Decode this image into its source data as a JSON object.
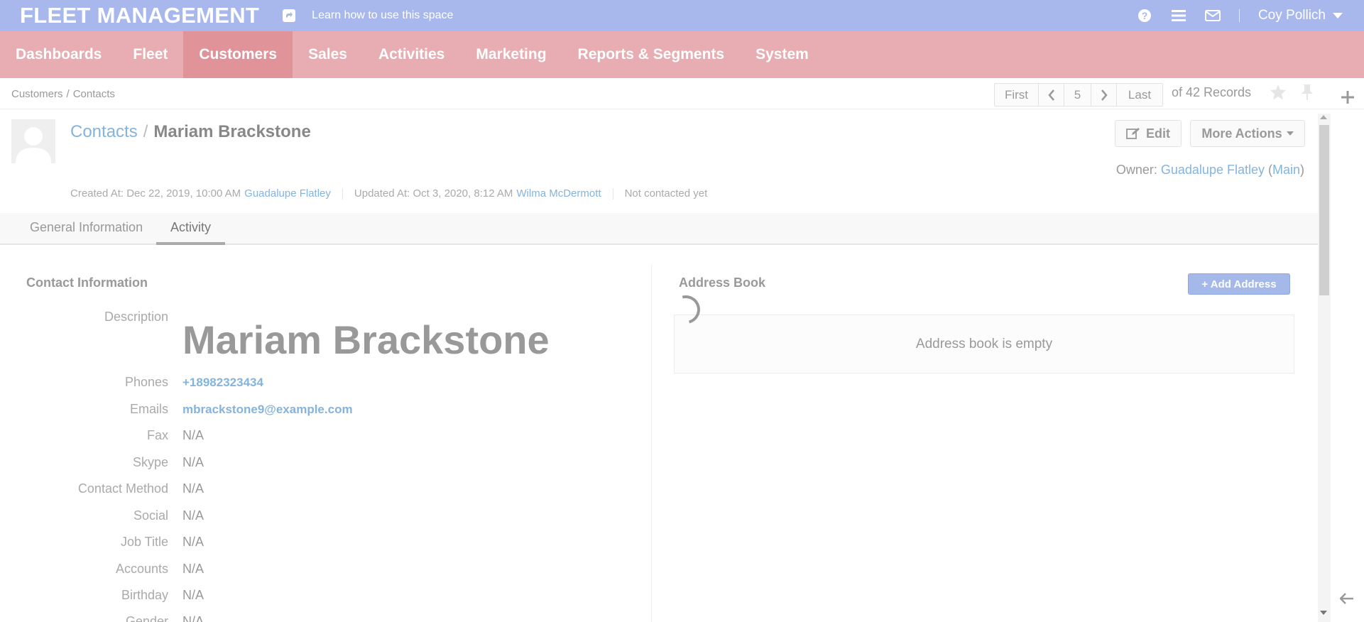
{
  "app": {
    "brand": "FLEET MANAGEMENT",
    "learn_link": "Learn how to use this space",
    "user_name": "Coy Pollich"
  },
  "nav": {
    "items": [
      "Dashboards",
      "Fleet",
      "Customers",
      "Sales",
      "Activities",
      "Marketing",
      "Reports & Segments",
      "System"
    ],
    "active": "Customers"
  },
  "breadcrumb": {
    "root": "Customers",
    "separator": "/",
    "current": "Contacts"
  },
  "pager": {
    "first": "First",
    "page": "5",
    "last": "Last",
    "records": "of 42 Records"
  },
  "header": {
    "title_link": "Contacts",
    "title_sep": "/",
    "name": "Mariam Brackstone",
    "edit": "Edit",
    "more_actions": "More Actions",
    "owner_label": "Owner:",
    "owner_name": "Guadalupe Flatley",
    "owner_unit": "Main",
    "created_label": "Created At: Dec 22, 2019, 10:00 AM",
    "created_by": "Guadalupe Flatley",
    "updated_label": "Updated At: Oct 3, 2020, 8:12 AM",
    "updated_by": "Wilma McDermott",
    "contacted": "Not contacted yet"
  },
  "tabs": {
    "general": "General Information",
    "activity": "Activity",
    "active": "Activity"
  },
  "contact_info": {
    "title": "Contact Information",
    "fields": [
      {
        "label": "Description",
        "value": "Mariam Brackstone"
      },
      {
        "label": "Phones",
        "value": "+18982323434"
      },
      {
        "label": "Emails",
        "value": "mbrackstone9@example.com"
      },
      {
        "label": "Fax",
        "value": "N/A"
      },
      {
        "label": "Skype",
        "value": "N/A"
      },
      {
        "label": "Contact Method",
        "value": "N/A"
      },
      {
        "label": "Social",
        "value": "N/A"
      },
      {
        "label": "Job Title",
        "value": "N/A"
      },
      {
        "label": "Accounts",
        "value": "N/A"
      },
      {
        "label": "Birthday",
        "value": "N/A"
      },
      {
        "label": "Gender",
        "value": "N/A"
      }
    ]
  },
  "address_book": {
    "title": "Address Book",
    "add_button": "+ Add Address",
    "empty_text": "Address book is empty"
  },
  "colors": {
    "topbar": "#a8b8ec",
    "mainnav": "#e8adb2",
    "nav_active": "#e0949a",
    "link": "#84b4de"
  },
  "icons": {
    "share": "share-icon",
    "help": "help-icon",
    "menu": "menu-icon",
    "mail": "mail-icon",
    "star": "star-icon",
    "pin": "pin-icon",
    "plus": "plus-icon",
    "back": "back-arrow-icon",
    "edit": "pencil-icon"
  }
}
